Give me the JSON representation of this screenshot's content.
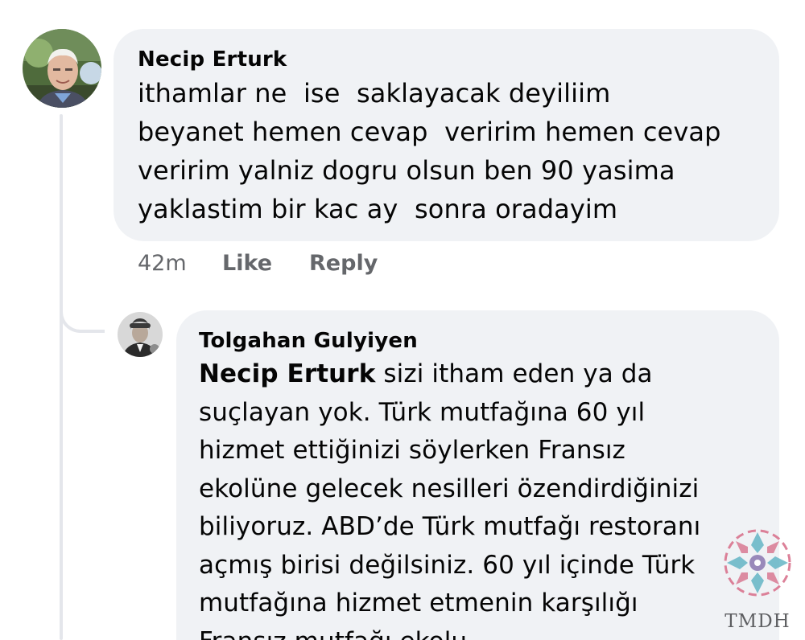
{
  "comments": [
    {
      "author": "Necip Erturk",
      "text": "ithamlar ne  ise  saklayacak deyiliim\nbeyanet hemen cevap  veririm hemen cevap\nveririm yalniz dogru olsun ben 90 yasima\nyaklastim bir kac ay  sonra oradayim",
      "time": "42m",
      "like_label": "Like",
      "reply_label": "Reply"
    },
    {
      "author": "Tolgahan Gulyiyen",
      "mention": "Necip Erturk",
      "text": " sizi itham eden ya da\nsuçlayan yok. Türk mutfağına 60 yıl\nhizmet ettiğinizi söylerken Fransız\nekolüne gelecek nesilleri özendirdiğinizi\nbiliyoruz. ABD’de Türk mutfağı restoranı\naçmış birisi değilsiniz. 60 yıl içinde Türk\nmutfağına hizmet etmenin karşılığı\nFransız mutfağı ekolu"
    }
  ],
  "watermark": {
    "text": "TMDH",
    "colors": [
      "#d9748e",
      "#5fb3c4",
      "#7f6aa8"
    ]
  }
}
